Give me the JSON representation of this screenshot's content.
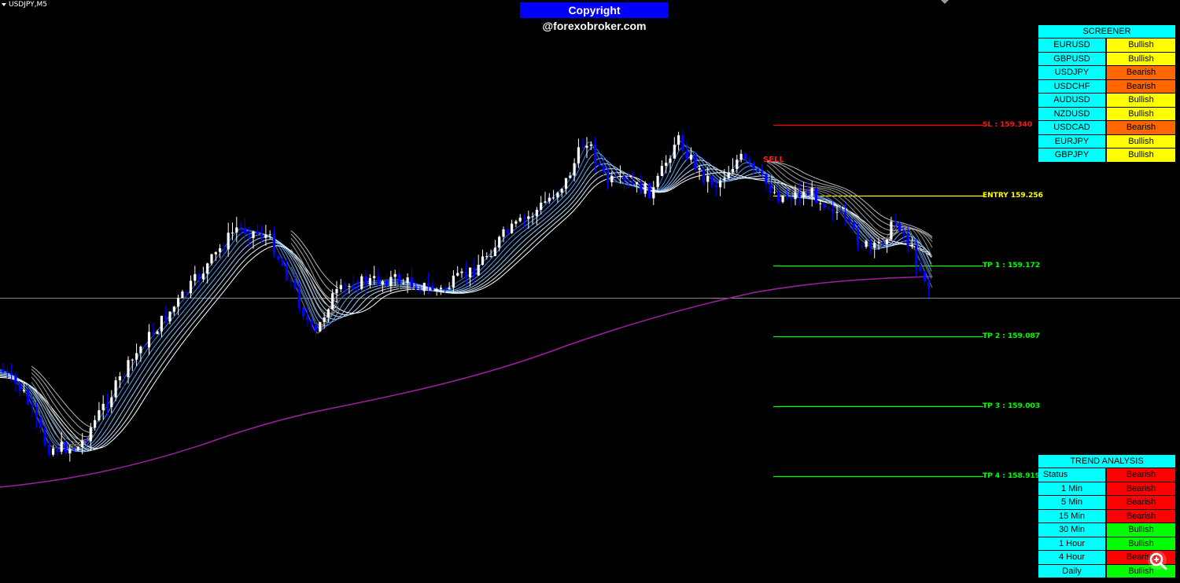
{
  "chart": {
    "symbol": "USDJPY,M5",
    "copyright": "Copyright @forexobroker.com",
    "signal": "SELL",
    "colors": {
      "background": "#000000",
      "bull_candle": "#ffffff",
      "bear_candle": "#0000ff",
      "ma_long": "#a020a0",
      "sl_line": "#ff0000",
      "entry_line": "#ffff00",
      "tp_line": "#00ff00"
    }
  },
  "levels": {
    "sl": "SL : 159.340",
    "entry": "ENTRY 159.256",
    "tp1": "TP 1 : 159.172",
    "tp2": "TP 2 : 159.087",
    "tp3": "TP 3 : 159.003",
    "tp4": "TP 4 : 158.919"
  },
  "screener": {
    "title": "SCREENER",
    "rows": [
      {
        "pair": "EURUSD",
        "status": "Bullish",
        "color": "#ffff00"
      },
      {
        "pair": "GBPUSD",
        "status": "Bullish",
        "color": "#ffff00"
      },
      {
        "pair": "USDJPY",
        "status": "Bearish",
        "color": "#ff6600"
      },
      {
        "pair": "USDCHF",
        "status": "Bearish",
        "color": "#ff6600"
      },
      {
        "pair": "AUDUSD",
        "status": "Bullish",
        "color": "#ffff00"
      },
      {
        "pair": "NZDUSD",
        "status": "Bullish",
        "color": "#ffff00"
      },
      {
        "pair": "USDCAD",
        "status": "Bearish",
        "color": "#ff6600"
      },
      {
        "pair": "EURJPY",
        "status": "Bullish",
        "color": "#ffff00"
      },
      {
        "pair": "GBPJPY",
        "status": "Bullish",
        "color": "#ffff00"
      }
    ]
  },
  "trend": {
    "title": "TREND ANALYSIS",
    "rows": [
      {
        "label": "Status",
        "status": "Bearish",
        "color": "#ff0000"
      },
      {
        "label": "1 Min",
        "status": "Bearish",
        "color": "#ff0000"
      },
      {
        "label": "5 Min",
        "status": "Bearish",
        "color": "#ff0000"
      },
      {
        "label": "15 Min",
        "status": "Bearish",
        "color": "#ff0000"
      },
      {
        "label": "30 Min",
        "status": "Bullish",
        "color": "#00ff00"
      },
      {
        "label": "1 Hour",
        "status": "Bullish",
        "color": "#00ff00"
      },
      {
        "label": "4 Hour",
        "status": "Bearish",
        "color": "#ff0000"
      },
      {
        "label": "Daily",
        "status": "Bullish",
        "color": "#00ff00"
      }
    ]
  },
  "icons": {
    "zoom": "zoom-magnifier-icon",
    "symbol_dropdown": "chevron-down-icon"
  }
}
